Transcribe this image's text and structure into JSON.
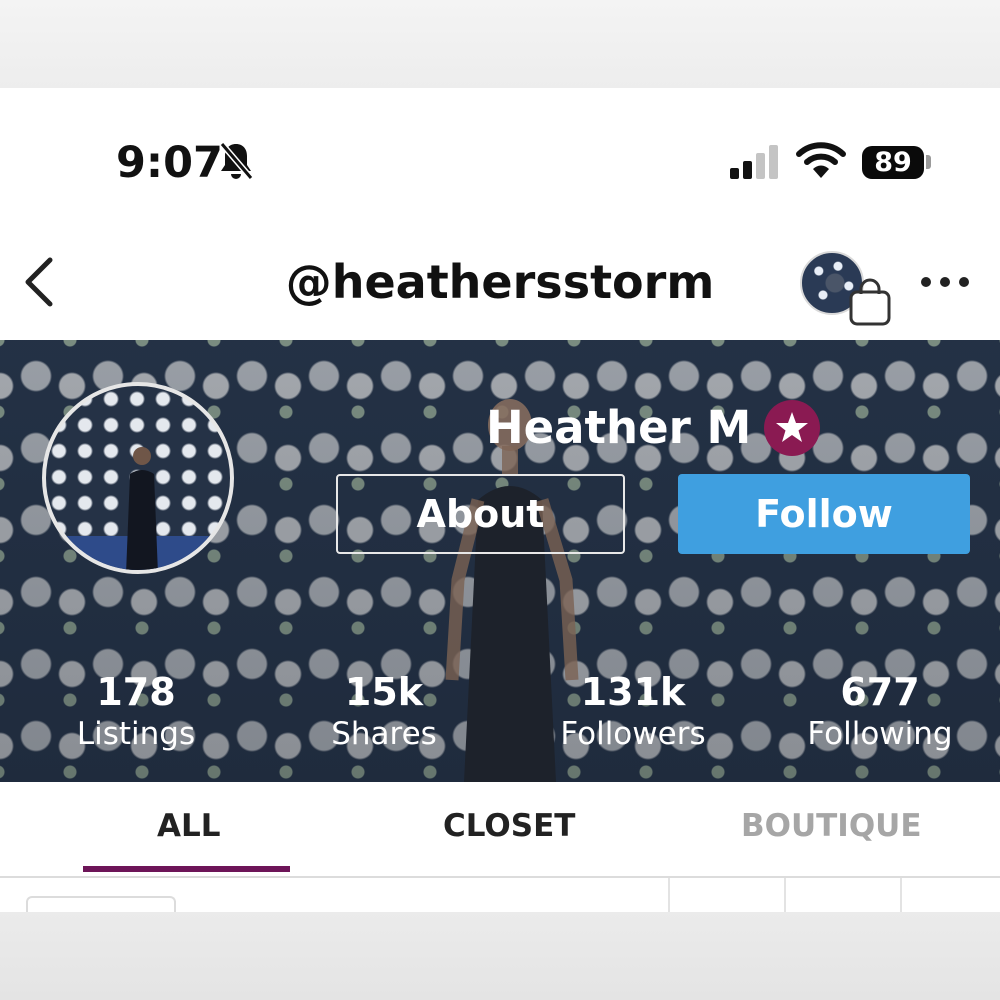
{
  "status_bar": {
    "time": "9:07",
    "battery": "89"
  },
  "nav": {
    "handle": "@heathersstorm"
  },
  "profile": {
    "name": "Heather M",
    "about_label": "About",
    "follow_label": "Follow",
    "stats": [
      {
        "value": "178",
        "label": "Listings"
      },
      {
        "value": "15k",
        "label": "Shares"
      },
      {
        "value": "131k",
        "label": "Followers"
      },
      {
        "value": "677",
        "label": "Following"
      }
    ]
  },
  "tabs": [
    {
      "label": "ALL",
      "active": true
    },
    {
      "label": "CLOSET",
      "active": false
    },
    {
      "label": "BOUTIQUE",
      "active": false
    }
  ],
  "colors": {
    "follow_button": "#3f9fe0",
    "active_tab_indicator": "#6d1558",
    "badge": "#8a1a52",
    "inactive_tab_text": "#a6a6a6"
  },
  "icons": [
    "bell-slash-icon",
    "cellular-signal-icon",
    "wifi-icon",
    "battery-icon",
    "back-chevron-icon",
    "shopping-bag-icon",
    "more-dots-icon",
    "star-badge-icon"
  ]
}
